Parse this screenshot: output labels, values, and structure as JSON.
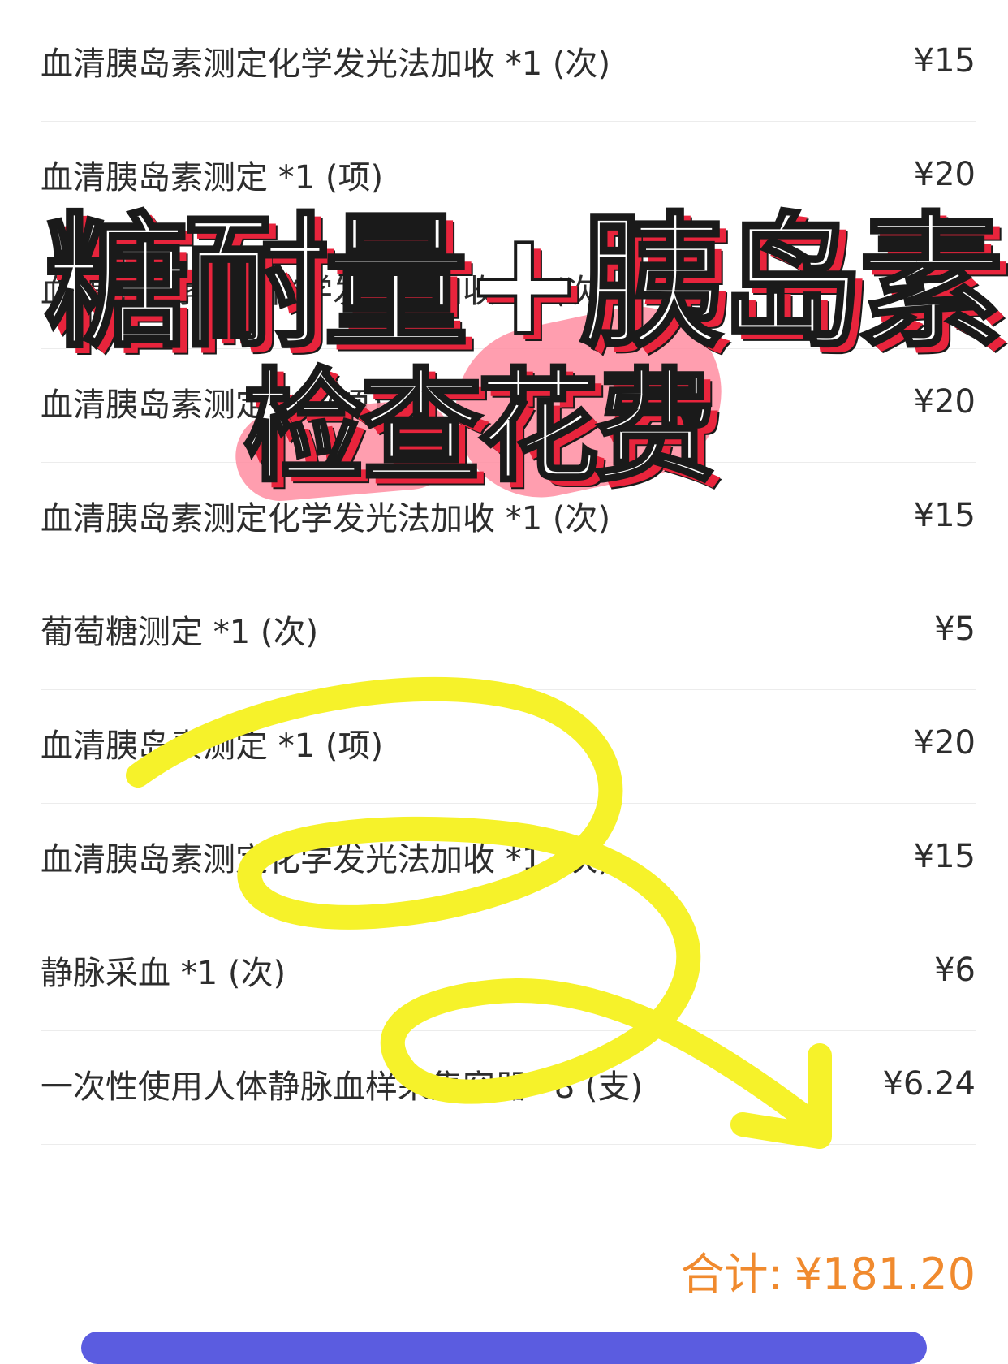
{
  "items": [
    {
      "name": "血清胰岛素测定化学发光法加收 *1 (次)",
      "price": "¥15"
    },
    {
      "name": "血清胰岛素测定 *1 (项)",
      "price": "¥20"
    },
    {
      "name": "血清胰岛素测定化学发光法加收 *1 (次)",
      "price": "¥15"
    },
    {
      "name": "血清胰岛素测定 *1 (项)",
      "price": "¥20"
    },
    {
      "name": "血清胰岛素测定化学发光法加收 *1 (次)",
      "price": "¥15"
    },
    {
      "name": "葡萄糖测定 *1 (次)",
      "price": "¥5"
    },
    {
      "name": "血清胰岛素测定 *1 (项)",
      "price": "¥20"
    },
    {
      "name": "血清胰岛素测定化学发光法加收 *1 (次)",
      "price": "¥15"
    },
    {
      "name": "静脉采血 *1 (次)",
      "price": "¥6"
    },
    {
      "name": "一次性使用人体静脉血样采集容器 *8 (支)",
      "price": "¥6.24"
    }
  ],
  "total": {
    "label": "合计:",
    "value": "¥181.20"
  },
  "overlay": {
    "title_line1": "糖耐量+胰岛素",
    "title_line2": "检查花费"
  },
  "colors": {
    "total": "#f08a2e",
    "button": "#5b5ce0",
    "title_shadow": "#e8243c",
    "scribble": "#f6f22a"
  }
}
